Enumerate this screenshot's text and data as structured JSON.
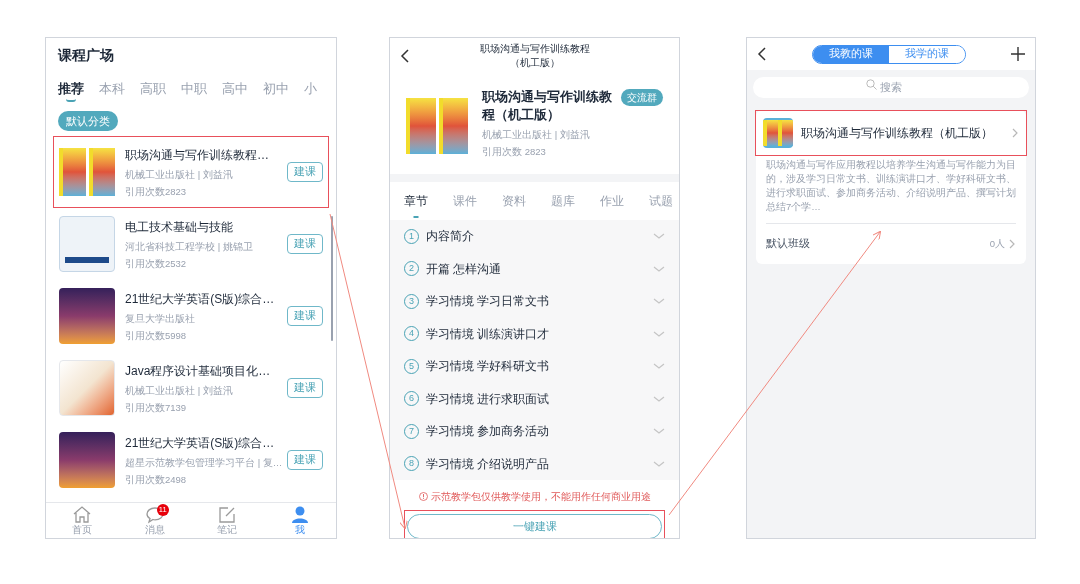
{
  "course_plaza": {
    "title": "课程广场",
    "tabs": [
      {
        "label": "推荐",
        "selected": true
      },
      {
        "label": "本科",
        "selected": false
      },
      {
        "label": "高职",
        "selected": false
      },
      {
        "label": "中职",
        "selected": false
      },
      {
        "label": "高中",
        "selected": false
      },
      {
        "label": "初中",
        "selected": false
      },
      {
        "label": "小",
        "selected": false
      }
    ],
    "category_chip": "默认分类",
    "courses": [
      {
        "title": "职场沟通与写作训练教程…",
        "publisher": "机械工业出版社 | 刘益汛",
        "citations": "引用次数2823",
        "button": "建课",
        "highlighted": true
      },
      {
        "title": "电工技术基础与技能",
        "publisher": "河北省科技工程学校 | 姚锦卫",
        "citations": "引用次数2532",
        "button": "建课",
        "highlighted": false
      },
      {
        "title": "21世纪大学英语(S版)综合…",
        "publisher": "复旦大学出版社",
        "citations": "引用次数5998",
        "button": "建课",
        "highlighted": false
      },
      {
        "title": "Java程序设计基础项目化…",
        "publisher": "机械工业出版社 | 刘益汛",
        "citations": "引用次数7139",
        "button": "建课",
        "highlighted": false
      },
      {
        "title": "21世纪大学英语(S版)综合…",
        "publisher": "超星示范教学包管理学习平台 | 复…",
        "citations": "引用次数2498",
        "button": "建课",
        "highlighted": false
      }
    ],
    "nav": [
      {
        "label": "首页",
        "selected": false
      },
      {
        "label": "消息",
        "badge": "11",
        "selected": false
      },
      {
        "label": "笔记",
        "selected": false
      },
      {
        "label": "我",
        "selected": true
      }
    ]
  },
  "course_detail": {
    "header_title": "职场沟通与写作训练教程（机工版）",
    "title": "职场沟通与写作训练教程（机工版）",
    "group_button": "交流群",
    "publisher": "机械工业出版社 | 刘益汛",
    "citations": "引用次数 2823",
    "tabs": [
      {
        "label": "章节",
        "selected": true
      },
      {
        "label": "课件",
        "selected": false
      },
      {
        "label": "资料",
        "selected": false
      },
      {
        "label": "题库",
        "selected": false
      },
      {
        "label": "作业",
        "selected": false
      },
      {
        "label": "试题",
        "selected": false
      }
    ],
    "chapters": [
      {
        "number": "1",
        "title": "内容简介"
      },
      {
        "number": "2",
        "title": "开篇 怎样沟通"
      },
      {
        "number": "3",
        "title": "学习情境 学习日常文书"
      },
      {
        "number": "4",
        "title": "学习情境 训练演讲口才"
      },
      {
        "number": "5",
        "title": "学习情境 学好科研文书"
      },
      {
        "number": "6",
        "title": "学习情境 进行求职面试"
      },
      {
        "number": "7",
        "title": "学习情境 参加商务活动"
      },
      {
        "number": "8",
        "title": "学习情境 介绍说明产品"
      }
    ],
    "notice": "示范教学包仅供教学使用，不能用作任何商业用途",
    "create_button": "一键建课",
    "create_highlighted": true
  },
  "my_courses": {
    "segments": [
      {
        "label": "我教的课",
        "selected": true
      },
      {
        "label": "我学的课",
        "selected": false
      }
    ],
    "search_placeholder": "搜索",
    "course": {
      "title": "职场沟通与写作训练教程（机工版）",
      "highlighted": true,
      "description": "职场沟通与写作应用教程以培养学生沟通与写作能力为目的，涉及学习日常文书、训练演讲口才、学好科研文书、进行求职面试、参加商务活动、介绍说明产品、撰写计划总结7个学…",
      "class_name": "默认班级",
      "class_count": "0人"
    }
  }
}
